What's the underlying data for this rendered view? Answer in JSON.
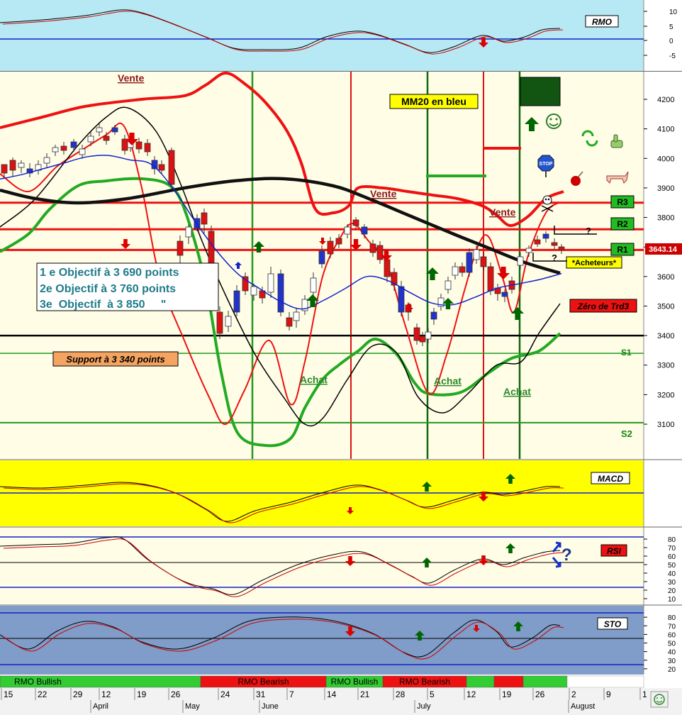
{
  "colors": {
    "rmo_bg": "#b7e9f4",
    "main_bg": "#fffde6",
    "macd_bg": "#ffff00",
    "rsi_bg": "#fffde6",
    "sto_bg": "#809cc8",
    "bull": "#33cc33",
    "bear": "#ee1111",
    "signal_red": "#dd0000",
    "signal_green": "#006600"
  },
  "panels": {
    "rmo": {
      "title": "RMO",
      "ticks": [
        "10",
        "5",
        "0",
        "-5"
      ]
    },
    "macd": {
      "title": "MACD"
    },
    "rsi": {
      "title": "RSI",
      "ticks": [
        "80",
        "70",
        "60",
        "50",
        "40",
        "30",
        "20",
        "10"
      ]
    },
    "sto": {
      "title": "STO",
      "ticks": [
        "80",
        "70",
        "60",
        "50",
        "40",
        "30",
        "20"
      ]
    }
  },
  "main": {
    "ticks": [
      "4200",
      "4100",
      "4000",
      "3900",
      "3800",
      "3700",
      "3600",
      "3500",
      "3400",
      "3300",
      "3200",
      "3100"
    ],
    "last_price": "3643.14",
    "labels": {
      "vente1": "Vente",
      "vente2": "Vente",
      "vente3": "Vente",
      "achat1": "Achat",
      "achat2": "Achat",
      "achat3": "Achat",
      "mm20": "MM20 en bleu",
      "acheteurs": "*Acheteurs*",
      "zero_trd": "Zéro de Trd3",
      "support": "Support à 3 340 points",
      "r1": "R1",
      "r2": "R2",
      "r3": "R3",
      "s1": "S1",
      "s2": "S2",
      "q1": "?",
      "q2": "?",
      "q_rsi": "?",
      "objectif1": "1 e Objectif  à 3 690  points",
      "objectif2": "2e  Objectif  à 3 760  points",
      "objectif3": "3e  Objectif  à 3 850     \""
    }
  },
  "rmo_bar": {
    "segments": [
      {
        "label": "RMO Bullish",
        "color": "#33cc33"
      },
      {
        "label": "RMO Bearish",
        "color": "#ee1111"
      },
      {
        "label": "RMO Bullish",
        "color": "#33cc33"
      },
      {
        "label": "RMO Bearish",
        "color": "#ee1111"
      },
      {
        "label": "",
        "color": "#33cc33"
      },
      {
        "label": "",
        "color": "#ee1111"
      },
      {
        "label": "",
        "color": "#33cc33"
      }
    ]
  },
  "date_axis": {
    "days": [
      "15",
      "22",
      "29",
      "12",
      "19",
      "26",
      "24",
      "31",
      "7",
      "14",
      "21",
      "28",
      "5",
      "12",
      "19",
      "26",
      "2",
      "9",
      "1"
    ],
    "months": [
      "April",
      "May",
      "June",
      "July",
      "August"
    ]
  },
  "chart_data": {
    "type": "candlestick",
    "ylim": [
      3020,
      4300
    ],
    "horizontal_levels": [
      {
        "name": "R3",
        "value": 3850
      },
      {
        "name": "R2",
        "value": 3760
      },
      {
        "name": "R1",
        "value": 3690
      },
      {
        "name": "Zéro de Trd3",
        "value": 3400
      },
      {
        "name": "S1",
        "value": 3340
      },
      {
        "name": "S2",
        "value": 3105
      }
    ],
    "series": [
      {
        "name": "MM20",
        "values": [
          3930,
          3945,
          3965,
          3985,
          4005,
          4010,
          3995,
          3980,
          3900,
          3790,
          3690,
          3610,
          3560,
          3515,
          3490,
          3520,
          3560,
          3600,
          3585,
          3545,
          3510,
          3505,
          3530,
          3560,
          3575,
          3590,
          3610
        ]
      }
    ]
  }
}
